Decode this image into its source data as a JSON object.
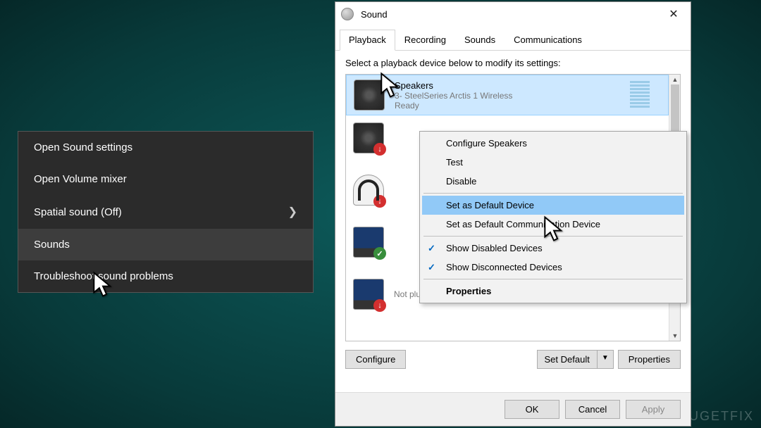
{
  "watermark": "UGETFIX",
  "darkMenu": {
    "items": [
      {
        "label": "Open Sound settings"
      },
      {
        "label": "Open Volume mixer"
      },
      {
        "label": "Spatial sound (Off)"
      },
      {
        "label": "Sounds"
      },
      {
        "label": "Troubleshoot sound problems"
      }
    ]
  },
  "window": {
    "title": "Sound",
    "tabs": [
      {
        "label": "Playback"
      },
      {
        "label": "Recording"
      },
      {
        "label": "Sounds"
      },
      {
        "label": "Communications"
      }
    ],
    "instruction": "Select a playback device below to modify its settings:",
    "devices": [
      {
        "name": "Speakers",
        "desc": "3- SteelSeries Arctis 1 Wireless",
        "status": "Ready"
      },
      {
        "name": "",
        "desc": "",
        "status": ""
      },
      {
        "name": "",
        "desc": "",
        "status": ""
      },
      {
        "name": "",
        "desc": "",
        "status": ""
      },
      {
        "name": "",
        "desc": "",
        "status": "Not plugged in"
      }
    ],
    "buttons": {
      "configure": "Configure",
      "setDefault": "Set Default",
      "properties": "Properties",
      "ok": "OK",
      "cancel": "Cancel",
      "apply": "Apply"
    }
  },
  "contextMenu": {
    "items": [
      {
        "label": "Configure Speakers"
      },
      {
        "label": "Test"
      },
      {
        "label": "Disable"
      },
      {
        "label": "Set as Default Device"
      },
      {
        "label": "Set as Default Communication Device"
      },
      {
        "label": "Show Disabled Devices"
      },
      {
        "label": "Show Disconnected Devices"
      },
      {
        "label": "Properties"
      }
    ]
  }
}
